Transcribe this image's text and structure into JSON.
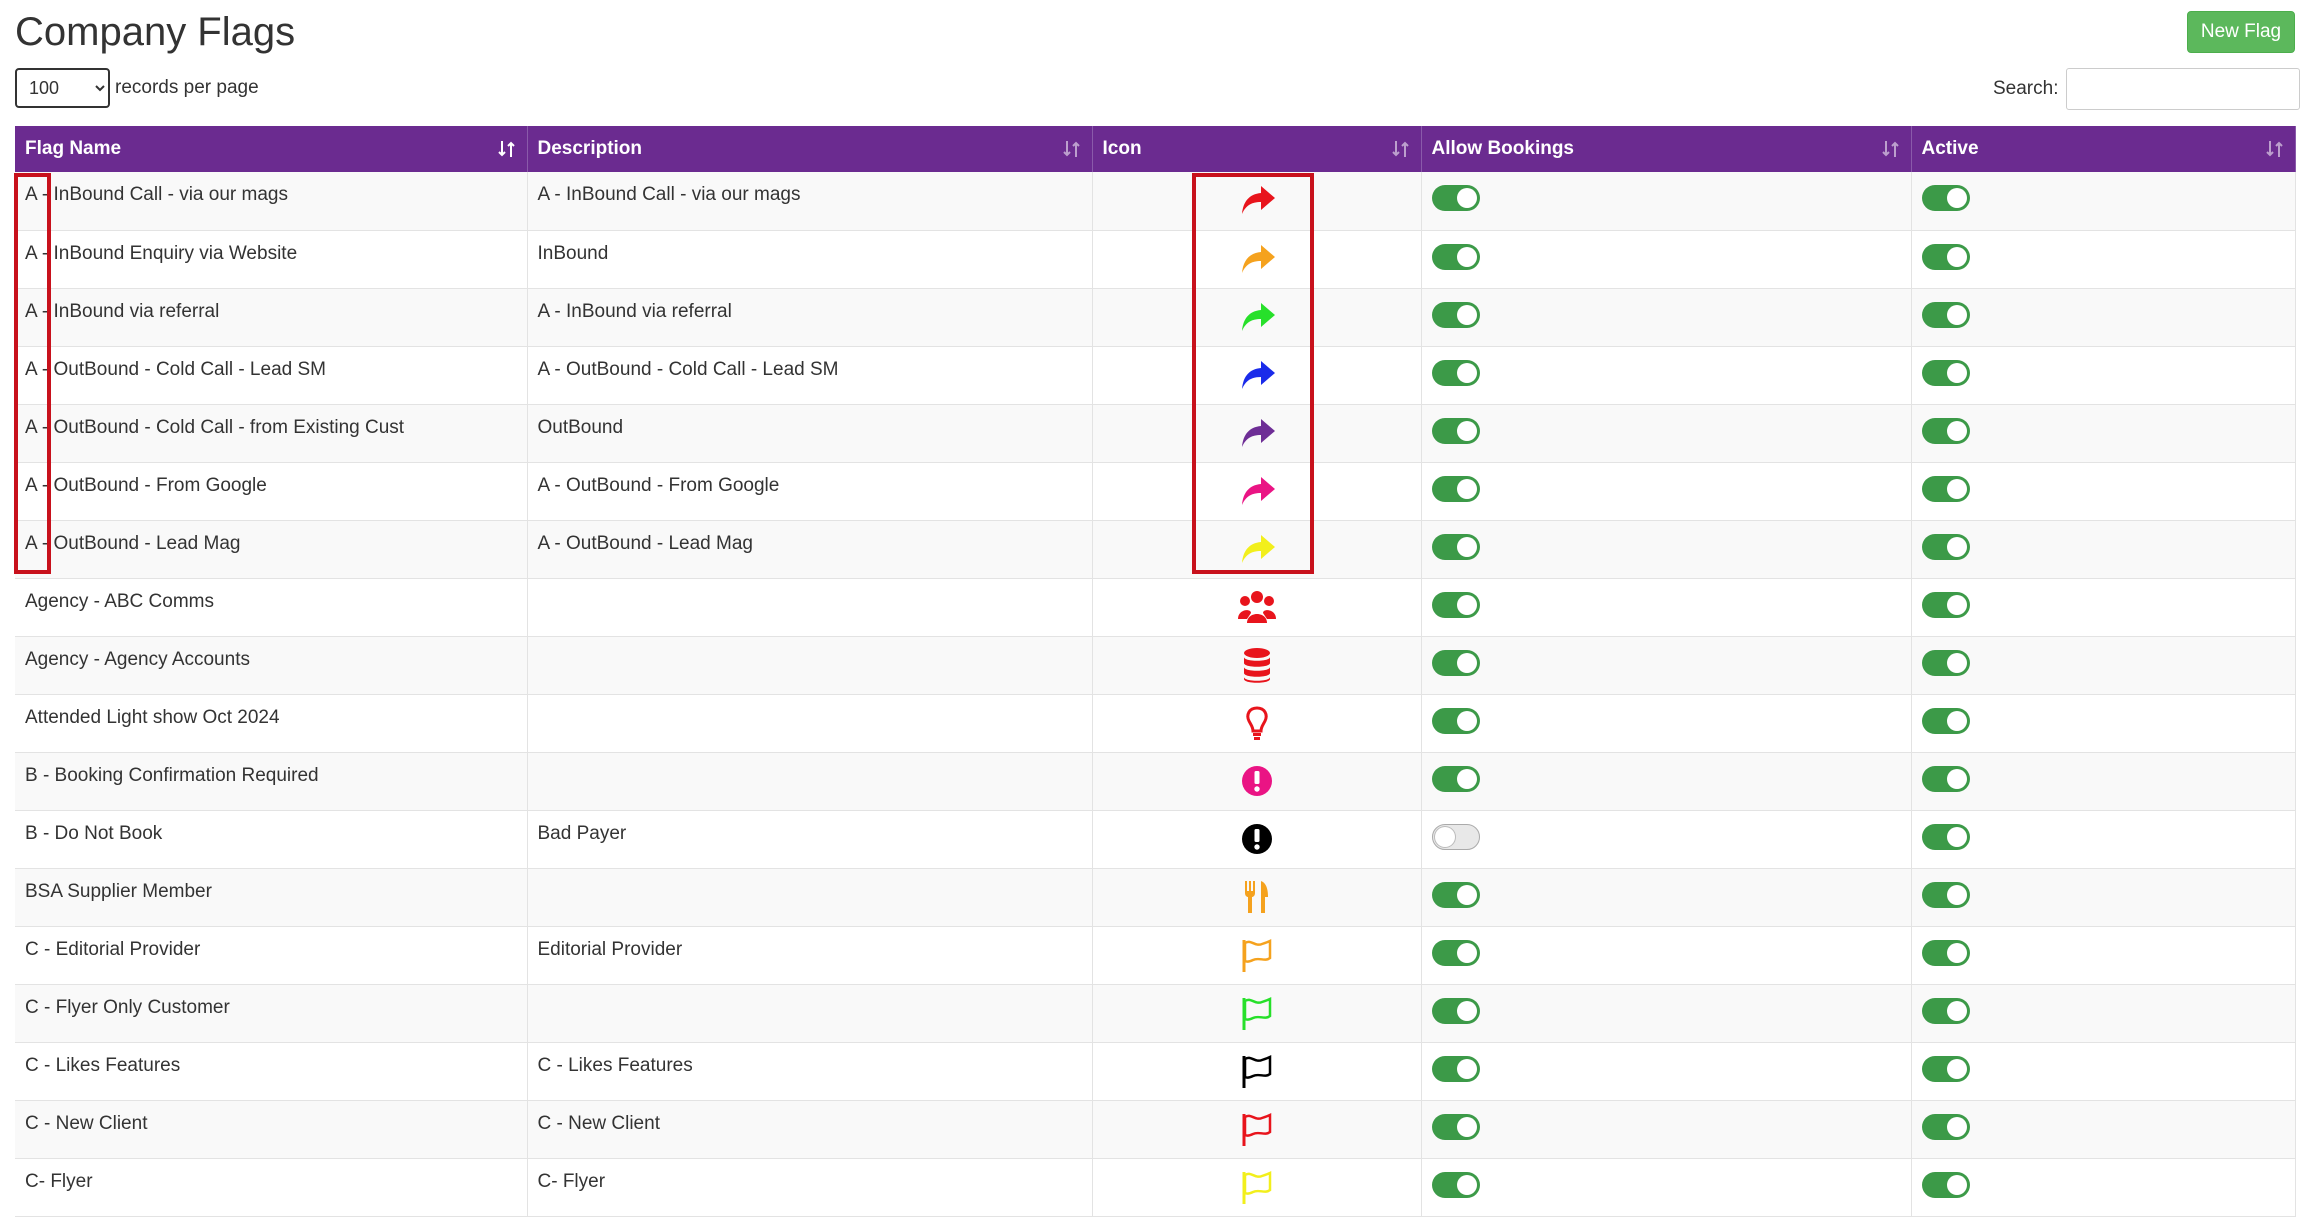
{
  "page": {
    "title": "Company Flags",
    "new_button_label": "New Flag",
    "records_per_page_value": "100",
    "records_per_page_label": "records per page",
    "search_label": "Search:",
    "search_value": ""
  },
  "table": {
    "columns": [
      "Flag Name",
      "Description",
      "Icon",
      "Allow Bookings",
      "Active"
    ],
    "rows": [
      {
        "name": "A - InBound Call - via our mags",
        "description": "A - InBound Call - via our mags",
        "icon": "share-arrow-icon",
        "color": "#e8141c",
        "allow_bookings": true,
        "active": true
      },
      {
        "name": "A - InBound Enquiry via Website",
        "description": "InBound",
        "icon": "share-arrow-icon",
        "color": "#f5a21e",
        "allow_bookings": true,
        "active": true
      },
      {
        "name": "A - InBound via referral",
        "description": "A - InBound via referral",
        "icon": "share-arrow-icon",
        "color": "#27e02a",
        "allow_bookings": true,
        "active": true
      },
      {
        "name": "A - OutBound - Cold Call - Lead SM",
        "description": "A - OutBound - Cold Call - Lead SM",
        "icon": "share-arrow-icon",
        "color": "#1a2bea",
        "allow_bookings": true,
        "active": true
      },
      {
        "name": "A - OutBound - Cold Call - from Existing Cust",
        "description": "OutBound",
        "icon": "share-arrow-icon",
        "color": "#6e2e96",
        "allow_bookings": true,
        "active": true
      },
      {
        "name": "A - OutBound - From Google",
        "description": "A - OutBound - From Google",
        "icon": "share-arrow-icon",
        "color": "#ea1484",
        "allow_bookings": true,
        "active": true
      },
      {
        "name": "A - OutBound - Lead Mag",
        "description": "A - OutBound - Lead Mag",
        "icon": "share-arrow-icon",
        "color": "#f2ef1c",
        "allow_bookings": true,
        "active": true
      },
      {
        "name": "Agency - ABC Comms",
        "description": "",
        "icon": "users-icon",
        "color": "#e8141c",
        "allow_bookings": true,
        "active": true
      },
      {
        "name": "Agency - Agency Accounts",
        "description": "",
        "icon": "database-icon",
        "color": "#e8141c",
        "allow_bookings": true,
        "active": true
      },
      {
        "name": "Attended Light show Oct 2024",
        "description": "",
        "icon": "lightbulb-icon",
        "color": "#e8141c",
        "allow_bookings": true,
        "active": true
      },
      {
        "name": "B - Booking Confirmation Required",
        "description": "",
        "icon": "exclamation-circle-icon",
        "color": "#ea1484",
        "allow_bookings": true,
        "active": true
      },
      {
        "name": "B - Do Not Book",
        "description": "Bad Payer",
        "icon": "exclamation-circle-icon",
        "color": "#000000",
        "allow_bookings": false,
        "active": true
      },
      {
        "name": "BSA Supplier Member",
        "description": "",
        "icon": "cutlery-icon",
        "color": "#f5a21e",
        "allow_bookings": true,
        "active": true
      },
      {
        "name": "C - Editorial Provider",
        "description": "Editorial Provider",
        "icon": "flag-outline-icon",
        "color": "#f5a21e",
        "allow_bookings": true,
        "active": true
      },
      {
        "name": "C - Flyer Only Customer",
        "description": "",
        "icon": "flag-outline-icon",
        "color": "#27e02a",
        "allow_bookings": true,
        "active": true
      },
      {
        "name": "C - Likes Features",
        "description": "C - Likes Features",
        "icon": "flag-outline-icon",
        "color": "#000000",
        "allow_bookings": true,
        "active": true
      },
      {
        "name": "C - New Client",
        "description": "C - New Client",
        "icon": "flag-outline-icon",
        "color": "#e8141c",
        "allow_bookings": true,
        "active": true
      },
      {
        "name": "C- Flyer",
        "description": "C- Flyer",
        "icon": "flag-outline-icon",
        "color": "#f2ef1c",
        "allow_bookings": true,
        "active": true
      }
    ]
  },
  "colors": {
    "header_bg": "#6b2b90",
    "toggle_on": "#3c9a48",
    "new_button": "#5cb85c",
    "highlight_border": "#c8111c"
  }
}
